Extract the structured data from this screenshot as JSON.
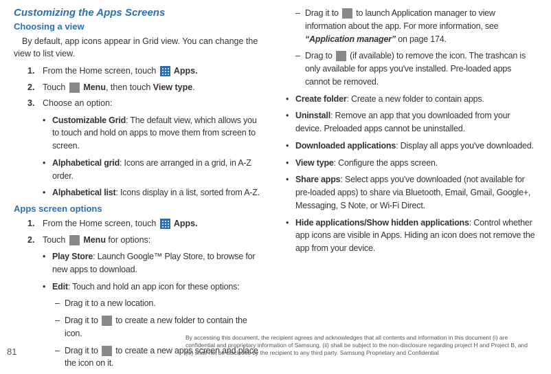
{
  "left": {
    "h1": "Customizing the Apps Screens",
    "h2a": "Choosing a view",
    "intro": "By default, app icons appear in Grid view. You can change the view to list view.",
    "step1_pre": "From the Home screen, touch ",
    "step1_post": " Apps.",
    "step2_pre": "Touch ",
    "step2_mid": " Menu",
    "step2_post": ", then touch ",
    "step2_bold": "View type",
    "step2_end": ".",
    "step3": "Choose an option:",
    "opt1_bold": "Customizable Grid",
    "opt1_rest": ": The default view, which allows you to touch and hold on apps to move them from screen to screen.",
    "opt2_bold": "Alphabetical grid",
    "opt2_rest": ": Icons are arranged in a grid, in A-Z order.",
    "opt3_bold": "Alphabetical list",
    "opt3_rest": ": Icons display in a list, sorted from A-Z.",
    "h2b": "Apps screen options",
    "bstep1_pre": "From the Home screen, touch ",
    "bstep1_post": " Apps.",
    "bstep2_pre": "Touch ",
    "bstep2_mid": " Menu",
    "bstep2_post": " for options:",
    "bopt1_bold": "Play Store",
    "bopt1_rest": ": Launch Google™ Play Store, to browse for new apps to download.",
    "bopt2_bold": "Edit",
    "bopt2_rest": ": Touch and hold an app icon for these options:",
    "dash1": "Drag it to a new location.",
    "dash2_pre": "Drag it to ",
    "dash2_post": " to create a new folder to contain the icon.",
    "dash3_pre": "Drag it to ",
    "dash3_post": " to create a new apps screen and place the icon on it."
  },
  "right": {
    "dashA_pre": "Drag it to ",
    "dashA_post": " to launch Application manager to view information about the app. For more information, see ",
    "dashA_quote": "“Application manager”",
    "dashA_end": " on page 174.",
    "dashB_pre": "Drag to ",
    "dashB_post": " (if available) to remove the icon. The trashcan is only available for apps you've installed. Pre-loaded apps cannot be removed.",
    "b1_bold": "Create folder",
    "b1_rest": ": Create a new folder to contain apps.",
    "b2_bold": "Uninstall",
    "b2_rest": ": Remove an app that you downloaded from your device. Preloaded apps cannot be uninstalled.",
    "b3_bold": "Downloaded applications",
    "b3_rest": ": Display all apps you've downloaded.",
    "b4_bold": "View type",
    "b4_rest": ": Configure the apps screen.",
    "b5_bold": "Share apps",
    "b5_rest": ": Select apps you've downloaded (not available for pre-loaded apps) to share via Bluetooth, Email, Gmail, Google+, Messaging, S Note, or Wi-Fi Direct.",
    "b6_bold": "Hide applications/Show hidden applications",
    "b6_rest": ": Control whether app icons are visible in Apps. Hiding an icon does not remove the app from your device."
  },
  "footer": {
    "pagenum": "81",
    "disclaimer": "By accessing this document, the recipient agrees and acknowledges that all contents and information in this document (i) are confidential and proprietary information of Samsung, (ii) shall be subject to the non-disclosure regarding project H and Project B, and (iii) shall not be disclosed by the recipient to any third party. Samsung Proprietary and Confidential"
  }
}
